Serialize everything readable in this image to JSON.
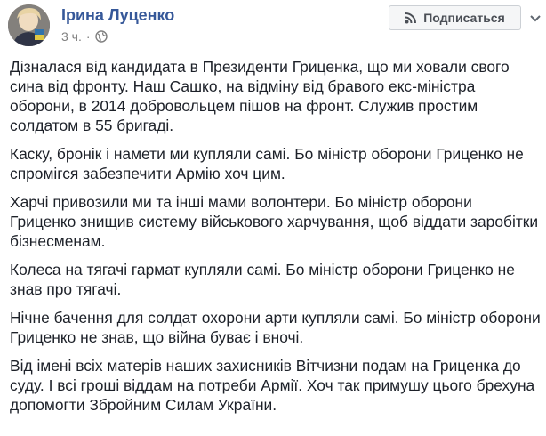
{
  "author": {
    "name": "Ірина Луценко",
    "time": "3 ч.",
    "separator": "·",
    "avatar": "avatar-photo",
    "privacy_icon": "globe-icon"
  },
  "actions": {
    "subscribe_label": "Подписаться",
    "subscribe_icon": "rss-icon",
    "more_icon": "chevron-down-icon"
  },
  "post": {
    "paragraphs": [
      "Дізналася від кандидата в Президенти Гриценка, що ми ховали свого сина від фронту. Наш Сашко, на відміну від бравого екс-міністра оборони, в 2014 добровольцем пішов на фронт. Служив простим солдатом в 55 бригаді.",
      "Каску, бронік і намети ми купляли самі. Бо міністр оборони Гриценко не спромігся забезпечити Армію хоч цим.",
      "Харчі привозили ми та інші мами волонтери. Бо міністр оборони Гриценко знищив систему військового харчування, щоб віддати заробітки бізнесменам.",
      "Колеса на тягачі гармат купляли самі. Бо міністр оборони Гриценко не знав про тягачі.",
      "Нічне бачення для солдат охорони арти купляли самі. Бо міністр оборони Гриценко не знав, що війна буває і вночі.",
      "Від імені всіх матерів наших захисників Вітчизни подам на Гриценка до суду. І всі гроші віддам на потреби Армії. Хоч так примушу цього брехуна допомогти Збройним Силам України."
    ]
  },
  "colors": {
    "author_link": "#365899",
    "text": "#1d2129",
    "meta": "#7f7f7f",
    "button_bg": "#f5f6f7",
    "button_border": "#ccd0d5"
  }
}
